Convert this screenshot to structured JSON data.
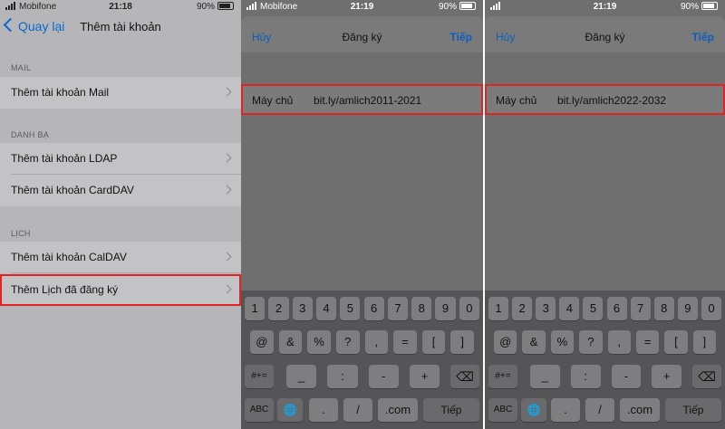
{
  "pane1": {
    "status": {
      "carrier": "Mobifone",
      "time": "21:18",
      "battery": "90%"
    },
    "nav": {
      "back_label": "Quay lại",
      "title": "Thêm tài khoản"
    },
    "sections": [
      {
        "header": "MAIL",
        "rows": [
          "Thêm tài khoản Mail"
        ]
      },
      {
        "header": "DANH BẠ",
        "rows": [
          "Thêm tài khoản LDAP",
          "Thêm tài khoản CardDAV"
        ]
      },
      {
        "header": "LỊCH",
        "rows": [
          "Thêm tài khoản CalDAV",
          "Thêm Lịch đã đăng ký"
        ]
      }
    ]
  },
  "pane2": {
    "status": {
      "carrier": "Mobifone",
      "time": "21:19",
      "battery": "90%"
    },
    "nav": {
      "cancel": "Hủy",
      "title": "Đăng ký",
      "next": "Tiếp"
    },
    "field": {
      "label": "Máy chủ",
      "value": "bit.ly/amlich2011-2021"
    }
  },
  "pane3": {
    "status": {
      "carrier": "",
      "time": "21:19",
      "battery": "90%"
    },
    "nav": {
      "cancel": "Hủy",
      "title": "Đăng ký",
      "next": "Tiếp"
    },
    "field": {
      "label": "Máy chủ",
      "value": "bit.ly/amlich2022-2032"
    }
  },
  "keyboard": {
    "row1": [
      "1",
      "2",
      "3",
      "4",
      "5",
      "6",
      "7",
      "8",
      "9",
      "0"
    ],
    "row2": [
      "@",
      "&",
      "%",
      "?",
      ",",
      "=",
      "[",
      "]"
    ],
    "row3": [
      "#+=",
      "_",
      ":",
      "-",
      "+"
    ],
    "row4": [
      "ABC",
      ".",
      "/",
      ".com",
      "Tiếp"
    ]
  },
  "colors": {
    "accent": "#0a68d0",
    "highlight": "#e02323"
  }
}
